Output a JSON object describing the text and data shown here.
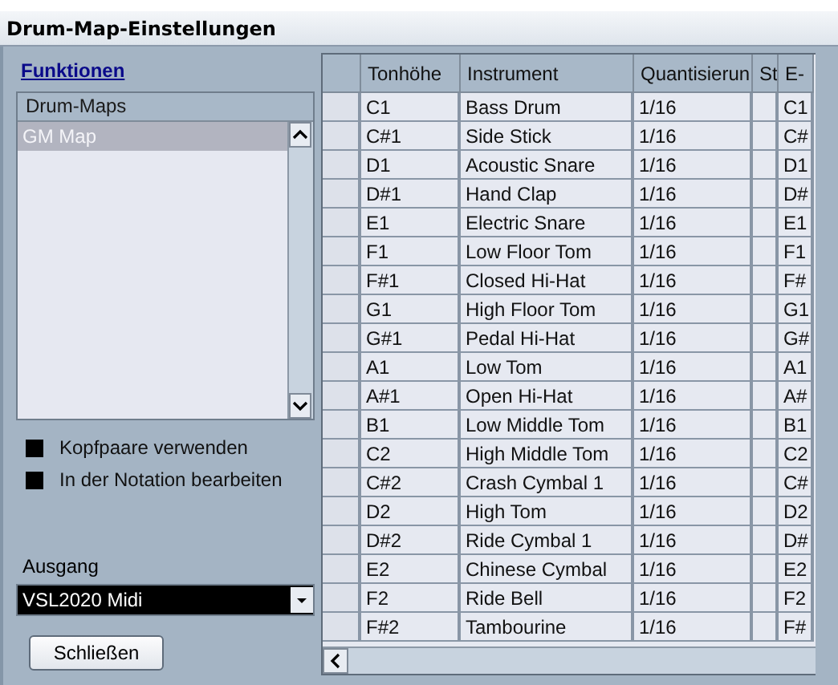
{
  "window": {
    "title": "Drum-Map-Einstellungen"
  },
  "functions_link": "Funktionen",
  "drum_maps": {
    "header": "Drum-Maps",
    "items": [
      {
        "label": "GM Map",
        "selected": true
      }
    ]
  },
  "options": [
    {
      "label": "Kopfpaare verwenden",
      "checked": true
    },
    {
      "label": "In der Notation bearbeiten",
      "checked": true
    }
  ],
  "output": {
    "label": "Ausgang",
    "value": "VSL2020 Midi"
  },
  "close_button": "Schließen",
  "table": {
    "columns": [
      "Tonhöhe",
      "Instrument",
      "Quantisierun",
      "St",
      "E-"
    ],
    "rows": [
      [
        "C1",
        "Bass Drum",
        "1/16",
        "",
        "C1"
      ],
      [
        "C#1",
        "Side Stick",
        "1/16",
        "",
        "C#"
      ],
      [
        "D1",
        "Acoustic Snare",
        "1/16",
        "",
        "D1"
      ],
      [
        "D#1",
        "Hand Clap",
        "1/16",
        "",
        "D#"
      ],
      [
        "E1",
        "Electric Snare",
        "1/16",
        "",
        "E1"
      ],
      [
        "F1",
        "Low Floor Tom",
        "1/16",
        "",
        "F1"
      ],
      [
        "F#1",
        "Closed Hi-Hat",
        "1/16",
        "",
        "F#"
      ],
      [
        "G1",
        "High Floor Tom",
        "1/16",
        "",
        "G1"
      ],
      [
        "G#1",
        "Pedal Hi-Hat",
        "1/16",
        "",
        "G#"
      ],
      [
        "A1",
        "Low Tom",
        "1/16",
        "",
        "A1"
      ],
      [
        "A#1",
        "Open Hi-Hat",
        "1/16",
        "",
        "A#"
      ],
      [
        "B1",
        "Low Middle Tom",
        "1/16",
        "",
        "B1"
      ],
      [
        "C2",
        "High Middle Tom",
        "1/16",
        "",
        "C2"
      ],
      [
        "C#2",
        "Crash Cymbal 1",
        "1/16",
        "",
        "C#"
      ],
      [
        "D2",
        "High Tom",
        "1/16",
        "",
        "D2"
      ],
      [
        "D#2",
        "Ride Cymbal 1",
        "1/16",
        "",
        "D#"
      ],
      [
        "E2",
        "Chinese Cymbal",
        "1/16",
        "",
        "E2"
      ],
      [
        "F2",
        "Ride Bell",
        "1/16",
        "",
        "F2"
      ],
      [
        "F#2",
        "Tambourine",
        "1/16",
        "",
        "F#"
      ]
    ]
  }
}
